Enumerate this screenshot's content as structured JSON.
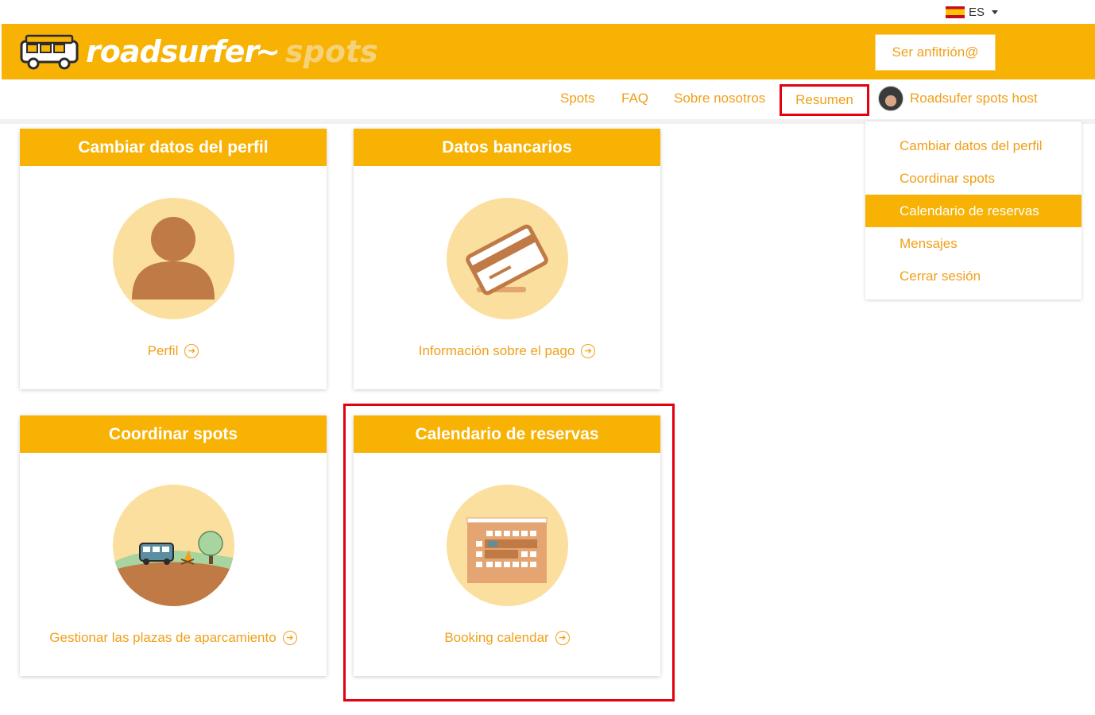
{
  "language": {
    "code": "ES",
    "flag_icon": "spain-flag-icon"
  },
  "brand": {
    "name_main": "roadsurfer",
    "name_wave": "~",
    "name_sub": "spots",
    "color": "#f8b204"
  },
  "header": {
    "host_button_label": "Ser anfitrión@"
  },
  "nav": {
    "items": [
      "Spots",
      "FAQ",
      "Sobre nosotros",
      "Resumen"
    ],
    "user_name": "Roadsufer spots host"
  },
  "dropdown": {
    "items": [
      "Cambiar datos del perfil",
      "Coordinar spots",
      "Calendario de reservas",
      "Mensajes",
      "Cerrar sesión"
    ],
    "active": "Calendario de reservas"
  },
  "cards": [
    {
      "title": "Cambiar datos del perfil",
      "link": "Perfil",
      "icon": "profile-icon"
    },
    {
      "title": "Datos bancarios",
      "link": "Información sobre el pago",
      "icon": "credit-card-icon"
    },
    {
      "title": "Coordinar spots",
      "link": "Gestionar las plazas de aparcamiento",
      "icon": "campsite-icon"
    },
    {
      "title": "Calendario de reservas",
      "link": "Booking calendar",
      "icon": "calendar-icon"
    }
  ],
  "colors": {
    "accent": "#f8b204",
    "link": "#f0a01a",
    "icon_bg": "#fbdf9e",
    "icon_fg": "#c07a45",
    "highlight": "#e3000f"
  }
}
